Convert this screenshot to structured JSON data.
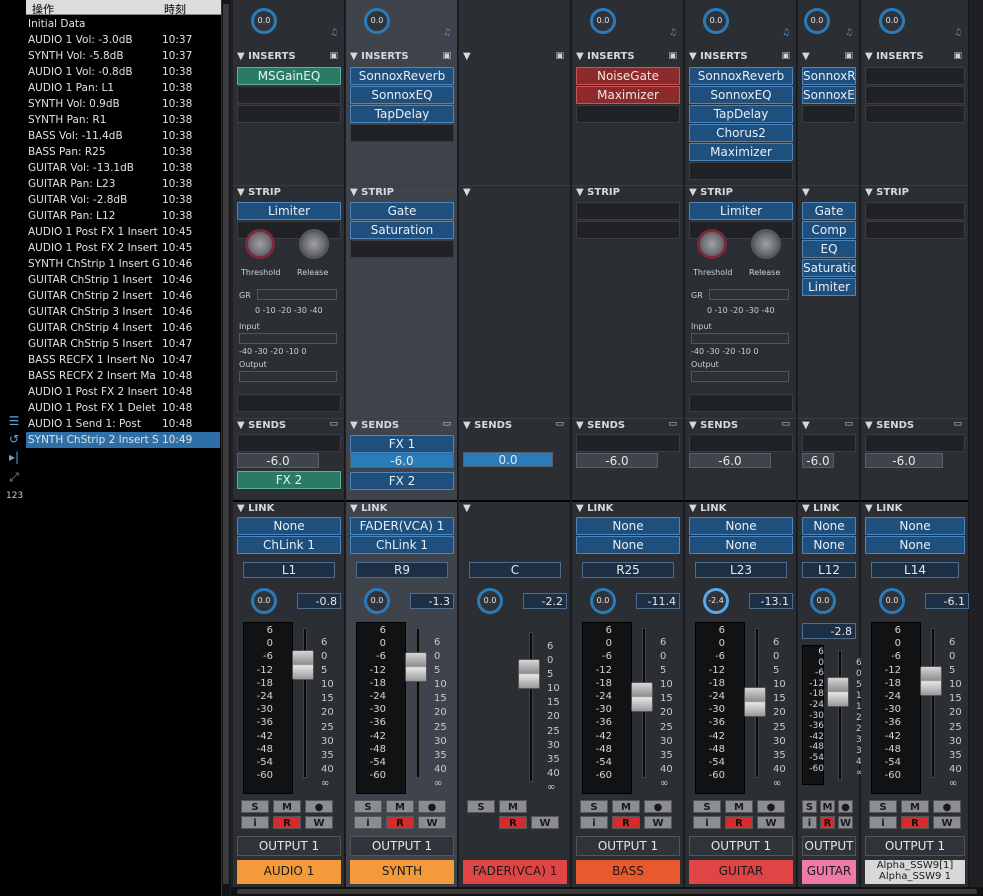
{
  "history": {
    "col_op": "操作",
    "col_time": "時刻",
    "rows": [
      {
        "op": "Initial Data",
        "time": ""
      },
      {
        "op": "AUDIO 1 Vol: -3.0dB",
        "time": "10:37"
      },
      {
        "op": "SYNTH Vol: -5.8dB",
        "time": "10:37"
      },
      {
        "op": "AUDIO 1 Vol: -0.8dB",
        "time": "10:38"
      },
      {
        "op": "AUDIO 1 Pan: L1",
        "time": "10:38"
      },
      {
        "op": "SYNTH Vol: 0.9dB",
        "time": "10:38"
      },
      {
        "op": "SYNTH Pan: R1",
        "time": "10:38"
      },
      {
        "op": "BASS Vol: -11.4dB",
        "time": "10:38"
      },
      {
        "op": "BASS Pan: R25",
        "time": "10:38"
      },
      {
        "op": "GUITAR Vol: -13.1dB",
        "time": "10:38"
      },
      {
        "op": "GUITAR Pan: L23",
        "time": "10:38"
      },
      {
        "op": "GUITAR Vol: -2.8dB",
        "time": "10:38"
      },
      {
        "op": "GUITAR Pan: L12",
        "time": "10:38"
      },
      {
        "op": "AUDIO 1 Post FX 1 Insert",
        "time": "10:45"
      },
      {
        "op": "AUDIO 1 Post FX 2 Insert",
        "time": "10:45"
      },
      {
        "op": "SYNTH ChStrip 1 Insert G",
        "time": "10:46"
      },
      {
        "op": "GUITAR ChStrip 1 Insert",
        "time": "10:46"
      },
      {
        "op": "GUITAR ChStrip 2 Insert",
        "time": "10:46"
      },
      {
        "op": "GUITAR ChStrip 3 Insert",
        "time": "10:46"
      },
      {
        "op": "GUITAR ChStrip 4 Insert",
        "time": "10:46"
      },
      {
        "op": "GUITAR ChStrip 5 Insert",
        "time": "10:47"
      },
      {
        "op": "BASS RECFX 1 Insert No",
        "time": "10:47"
      },
      {
        "op": "BASS RECFX 2 Insert Ma",
        "time": "10:48"
      },
      {
        "op": "AUDIO 1 Post FX 2 Insert",
        "time": "10:48"
      },
      {
        "op": "AUDIO 1 Post FX 1 Delet",
        "time": "10:48"
      },
      {
        "op": "AUDIO 1 Send 1: Post",
        "time": "10:48"
      },
      {
        "op": "SYNTH ChStrip 2 Insert S",
        "time": "10:49"
      }
    ],
    "side_count": "123"
  },
  "labels": {
    "inserts": "INSERTS",
    "strip": "STRIP",
    "sends": "SENDS",
    "link": "LINK",
    "threshold": "Threshold",
    "release": "Release",
    "gr": "GR",
    "input": "Input",
    "output": "Output",
    "gr_scale": "0  -10  -20  -30  -40",
    "io_scale": "-40  -30  -20  -10   0",
    "meter_scale": "6\n0\n-6\n-12\n-18\n-24\n-30\n-36\n-42\n-48\n-54\n-60",
    "fader_scale": "6\n0\n5\n10\n15\n20\n25\n30\n35\n40\n∞",
    "btn_s": "S",
    "btn_m": "M",
    "btn_i": "i",
    "btn_r": "R",
    "btn_w": "W",
    "btn_rec": "●"
  },
  "channels": [
    {
      "name": "AUDIO 1",
      "name_color": "#f39a3a",
      "output": "OUTPUT 1",
      "pan_knob": "0.0",
      "inserts": [
        "MSGainEQ"
      ],
      "insert_colors": [
        "green"
      ],
      "strip": [
        "Limiter"
      ],
      "send_value": "-6.0",
      "sends": [
        "FX 2"
      ],
      "send_colors": [
        "green"
      ],
      "link": [
        "None",
        "ChLink 1"
      ],
      "pan": "L1",
      "volume": "-0.8",
      "top_knob": "0.0",
      "has_comp": true
    },
    {
      "name": "SYNTH",
      "name_color": "#f39a3a",
      "output": "OUTPUT 1",
      "pan_knob": "0.0",
      "inserts": [
        "SonnoxReverb",
        "SonnoxEQ",
        "TapDelay"
      ],
      "insert_colors": [
        "blue",
        "blue",
        "blue"
      ],
      "strip": [
        "Gate",
        "Saturation"
      ],
      "send_value": "-6.0",
      "sends": [
        "FX 1",
        "FX 2"
      ],
      "send_colors": [
        "blue",
        "blue"
      ],
      "link": [
        "FADER(VCA) 1",
        "ChLink 1"
      ],
      "pan": "R9",
      "volume": "-1.3",
      "top_knob": "0.0",
      "has_comp": false
    },
    {
      "name": "FADER(VCA) 1",
      "name_color": "#e04444",
      "output": "",
      "pan_knob": "0.0",
      "inserts": [],
      "insert_colors": [],
      "strip": [],
      "send_value": "0.0",
      "sends": [],
      "send_colors": [],
      "link": [],
      "pan": "C",
      "volume": "-2.2",
      "top_knob": "",
      "has_comp": false
    },
    {
      "name": "BASS",
      "name_color": "#e85a2e",
      "output": "OUTPUT 1",
      "pan_knob": "0.0",
      "inserts": [
        "NoiseGate",
        "Maximizer"
      ],
      "insert_colors": [
        "red",
        "red"
      ],
      "strip": [],
      "send_value": "-6.0",
      "sends": [],
      "send_colors": [],
      "link": [
        "None",
        "None"
      ],
      "pan": "R25",
      "volume": "-11.4",
      "top_knob": "0.0",
      "has_comp": false
    },
    {
      "name": "GUITAR",
      "name_color": "#e04444",
      "output": "OUTPUT 1",
      "pan_knob": "-2.4",
      "inserts": [
        "SonnoxReverb",
        "SonnoxEQ",
        "TapDelay",
        "Chorus2",
        "Maximizer"
      ],
      "insert_colors": [
        "blue",
        "blue",
        "blue",
        "blue",
        "blue"
      ],
      "strip": [
        "Limiter"
      ],
      "send_value": "-6.0",
      "sends": [],
      "send_colors": [],
      "link": [
        "None",
        "None"
      ],
      "pan": "L23",
      "volume": "-13.1",
      "top_knob": "0.0",
      "has_comp": true
    },
    {
      "name": "GUITAR",
      "name_color": "#f07aa6",
      "output": "OUTPUT",
      "pan_knob": "0.0",
      "inserts": [
        "SonnoxRe",
        "SonnoxEQ"
      ],
      "insert_colors": [
        "blue",
        "blue"
      ],
      "strip": [
        "Gate",
        "Comp",
        "EQ",
        "Saturation",
        "Limiter"
      ],
      "send_value": "-6.0",
      "sends": [],
      "send_colors": [],
      "link": [
        "None",
        "None"
      ],
      "pan": "L12",
      "volume": "-2.8",
      "top_knob": "0.0",
      "has_comp": false
    },
    {
      "name": "Alpha_SSW9[1]\nAlpha_SSW9 1",
      "name_color": "#d8d8d8",
      "output": "OUTPUT 1",
      "pan_knob": "0.0",
      "inserts": [],
      "insert_colors": [],
      "strip": [],
      "send_value": "-6.0",
      "sends": [],
      "send_colors": [],
      "link": [
        "None",
        "None"
      ],
      "pan": "L14",
      "volume": "-6.1",
      "top_knob": "0.0",
      "has_comp": false
    }
  ]
}
